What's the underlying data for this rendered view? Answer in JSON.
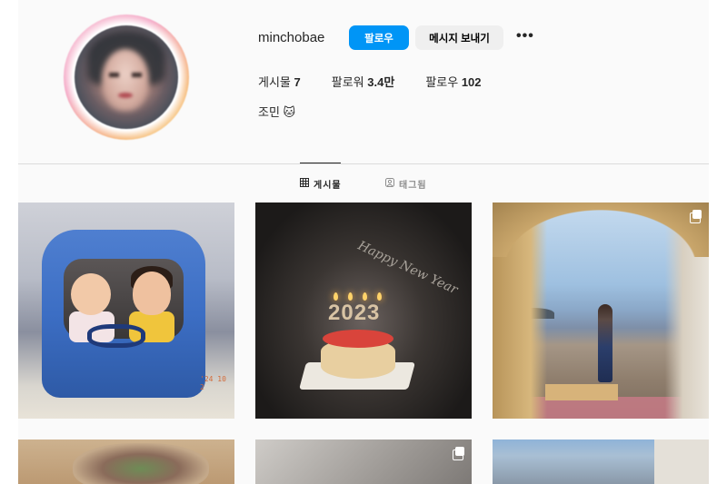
{
  "profile": {
    "username": "minchobae",
    "follow_label": "팔로우",
    "message_label": "메시지 보내기",
    "more_label": "•••",
    "stats": {
      "posts_label": "게시물",
      "posts_count": "7",
      "followers_label": "팔로워",
      "followers_count": "3.4만",
      "following_label": "팔로우",
      "following_count": "102"
    },
    "bio": "조민 🐱"
  },
  "tabs": {
    "posts_label": "게시물",
    "tagged_label": "태그됨",
    "posts_icon": "grid-icon",
    "tagged_icon": "tag-icon"
  },
  "posts": {
    "p1_stamp": "'24 10 2",
    "p2_number": "2023",
    "p2_topper": "Happy New Year"
  },
  "colors": {
    "accent": "#0095f6",
    "secondary_button": "#efefef"
  }
}
